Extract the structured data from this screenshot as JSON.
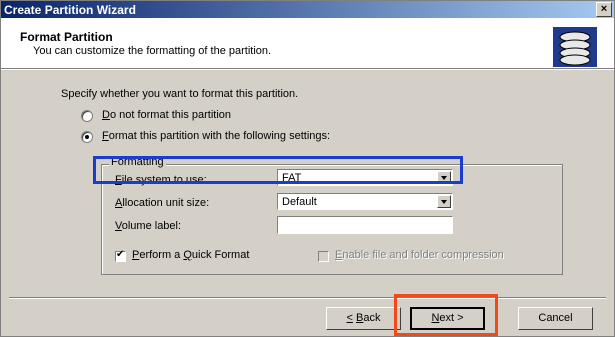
{
  "window": {
    "title": "Create Partition Wizard",
    "close_glyph": "×"
  },
  "header": {
    "title": "Format Partition",
    "subtitle": "You can customize the formatting of the partition.",
    "icon": "disk-stack-icon"
  },
  "body": {
    "intro": "Specify whether you want to format this partition.",
    "options": [
      {
        "label": "Do not format this partition",
        "selected": false
      },
      {
        "label": "Format this partition with the following settings:",
        "selected": true
      }
    ],
    "formatting": {
      "group_title": "Formatting",
      "file_system_label": "File system to use:",
      "file_system_value": "FAT",
      "allocation_label": "Allocation unit size:",
      "allocation_value": "Default",
      "volume_label_label": "Volume label:",
      "volume_label_value": "",
      "quick_format_label": "Perform a Quick Format",
      "quick_format_checked": true,
      "compression_label": "Enable file and folder compression",
      "compression_checked": false
    }
  },
  "buttons": {
    "back": "< Back",
    "next": "Next >",
    "cancel": "Cancel"
  },
  "highlights": {
    "blue": "#1a3ccf",
    "red": "#f04a1a"
  }
}
